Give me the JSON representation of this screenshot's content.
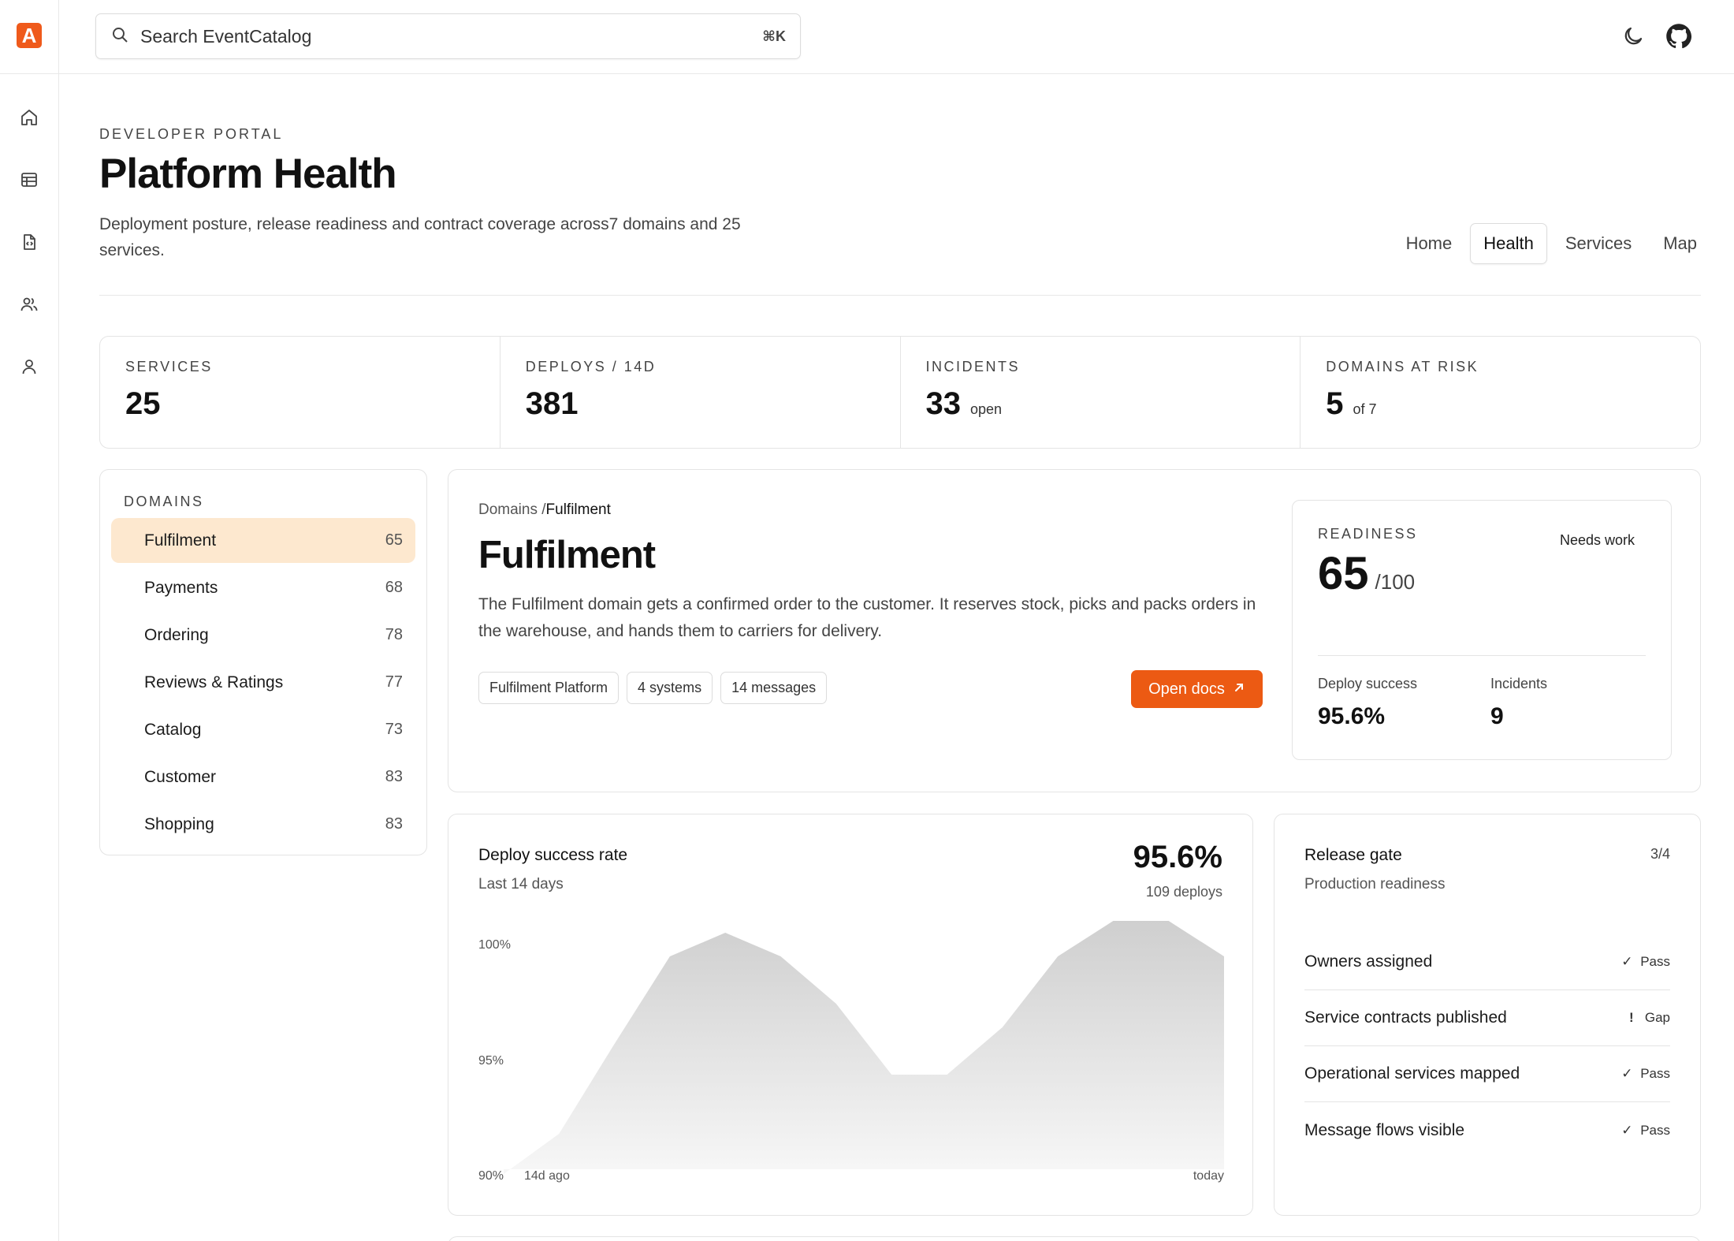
{
  "app": {
    "logo_letter": "A"
  },
  "search": {
    "placeholder": "Search EventCatalog",
    "shortcut": "⌘K"
  },
  "header": {
    "eyebrow": "DEVELOPER PORTAL",
    "title": "Platform Health",
    "subtitle": "Deployment posture, release readiness and contract coverage across7 domains and 25 services."
  },
  "nav": {
    "tabs": [
      {
        "label": "Home"
      },
      {
        "label": "Health"
      },
      {
        "label": "Services"
      },
      {
        "label": "Map"
      }
    ],
    "active": "Health"
  },
  "stats": [
    {
      "label": "SERVICES",
      "value": "25",
      "suffix": ""
    },
    {
      "label": "DEPLOYS / 14D",
      "value": "381",
      "suffix": ""
    },
    {
      "label": "INCIDENTS",
      "value": "33",
      "suffix": "open"
    },
    {
      "label": "DOMAINS AT RISK",
      "value": "5",
      "suffix": "of 7"
    }
  ],
  "domains": {
    "header": "DOMAINS",
    "items": [
      {
        "name": "Fulfilment",
        "count": "65"
      },
      {
        "name": "Payments",
        "count": "68"
      },
      {
        "name": "Ordering",
        "count": "78"
      },
      {
        "name": "Reviews & Ratings",
        "count": "77"
      },
      {
        "name": "Catalog",
        "count": "73"
      },
      {
        "name": "Customer",
        "count": "83"
      },
      {
        "name": "Shopping",
        "count": "83"
      }
    ]
  },
  "detail": {
    "crumb_root": "Domains /",
    "crumb_current": "Fulfilment",
    "title": "Fulfilment",
    "description": "The Fulfilment domain gets a confirmed order to the customer. It reserves stock, picks and packs orders in the warehouse, and hands them to carriers for delivery.",
    "chips": [
      "Fulfilment Platform",
      "4 systems",
      "14 messages"
    ],
    "docs_label": "Open docs"
  },
  "readiness": {
    "label": "READINESS",
    "status": "Needs work",
    "score": "65",
    "denominator": "/100",
    "deploy_label": "Deploy success",
    "deploy_value": "95.6%",
    "incidents_label": "Incidents",
    "incidents_value": "9"
  },
  "deploy_chart": {
    "title": "Deploy success rate",
    "subtitle": "Last 14 days",
    "value": "95.6%",
    "deploys": "109 deploys"
  },
  "chart_data": {
    "type": "area",
    "x_start_label": "14d ago",
    "x_end_label": "today",
    "y_ticks": [
      "100%",
      "95%",
      "90%"
    ],
    "ylim": [
      90,
      100
    ],
    "values": [
      89.8,
      91.5,
      95.3,
      99.0,
      100.0,
      99.0,
      97.0,
      94.0,
      94.0,
      96.0,
      99.0,
      101.0,
      101.0,
      99.0
    ]
  },
  "release_gate": {
    "title": "Release gate",
    "subtitle": "Production readiness",
    "count": "3/4",
    "rows": [
      {
        "label": "Owners assigned",
        "mark": "✓",
        "status": "Pass"
      },
      {
        "label": "Service contracts published",
        "mark": "!",
        "status": "Gap"
      },
      {
        "label": "Operational services mapped",
        "mark": "✓",
        "status": "Pass"
      },
      {
        "label": "Message flows visible",
        "mark": "✓",
        "status": "Pass"
      }
    ]
  },
  "colors": {
    "accent": "#ec5a13",
    "active_bg": "#fde8cf"
  }
}
